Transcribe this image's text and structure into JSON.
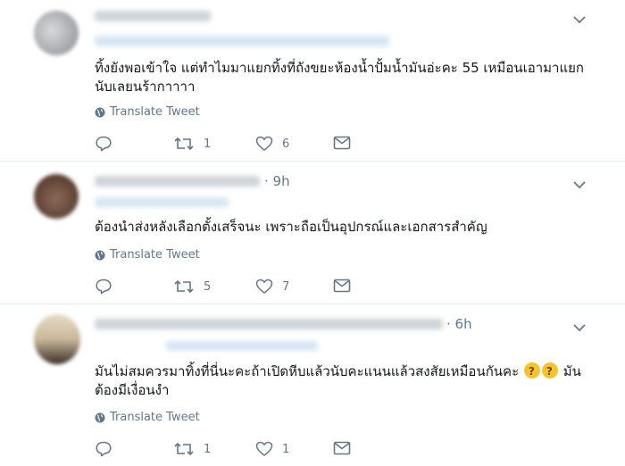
{
  "tweets": [
    {
      "time": "",
      "text": "ทิ้งยังพอเข้าใจ แต่ทำไมมาแยกทิ้งที่ถังขยะห้องน้ำปั้มน้ำมันอ่ะคะ 55 เหมือนเอามาแยกนับเลยนร้ากาาาา",
      "translate": "Translate Tweet",
      "replies": "",
      "retweets": "1",
      "likes": "6"
    },
    {
      "time": "· 9h",
      "text": "ต้องนำส่งหลังเลือกตั้งเสร็จนะ เพราะถือเป็นอุปกรณ์และเอกสารสำคัญ",
      "translate": "Translate Tweet",
      "replies": "",
      "retweets": "5",
      "likes": "7"
    },
    {
      "time": "· 6h",
      "text_a": "มันไม่สมควรมาทิ้งที่นี่นะคะถ้าเปิดหีบแล้วนับคะแนนแล้วสงสัยเหมือนกันคะ",
      "text_b": "มันต้องมีเงื่อนงำ",
      "emoji": "thinking-face",
      "translate": "Translate Tweet",
      "replies": "",
      "retweets": "1",
      "likes": "1"
    }
  ],
  "colors": {
    "muted": "#657786",
    "text": "#14171a",
    "divider": "#e6ecf0"
  }
}
